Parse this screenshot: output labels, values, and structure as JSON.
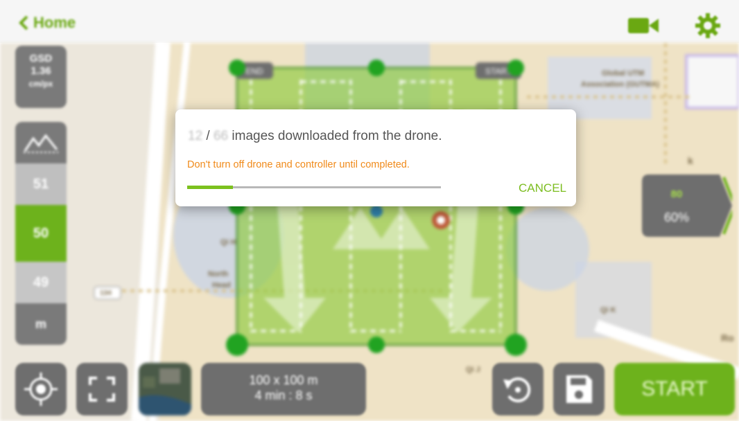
{
  "topbar": {
    "back_label": "Home",
    "camera_icon": "video-camera-icon",
    "settings_icon": "gear-icon",
    "accent_color": "#6aa812"
  },
  "map": {
    "labels": [
      "Global UTM",
      "Association (GUTMA)",
      "Qi K",
      "134",
      "North",
      "Head",
      "Qi J",
      "Qi H",
      "Ro",
      "k"
    ],
    "grid_labels": {
      "end": "END",
      "start": "START"
    }
  },
  "gsd": {
    "label": "GSD",
    "value": "1.36",
    "unit": "cm/px"
  },
  "altitude": {
    "icon": "terrain-icon",
    "above": "51",
    "selected": "50",
    "below": "49",
    "unit": "m"
  },
  "overlap": {
    "label": "80",
    "value": "60%"
  },
  "bottom": {
    "locate_icon": "locate-icon",
    "fit_icon": "fullscreen-icon",
    "map_type_icon": "satellite-thumbnail",
    "area": "100 x 100 m",
    "duration": "4 min : 8 s",
    "rotate_icon": "rotate-icon",
    "save_icon": "save-icon",
    "start_label": "START"
  },
  "dialog": {
    "downloaded": "12",
    "separator": " / ",
    "total": "66",
    "message": " images downloaded from the drone.",
    "warning": "Don't turn off drone and controller until completed.",
    "progress": 0.18,
    "cancel_label": "CANCEL",
    "warning_color": "#f08a1a"
  }
}
